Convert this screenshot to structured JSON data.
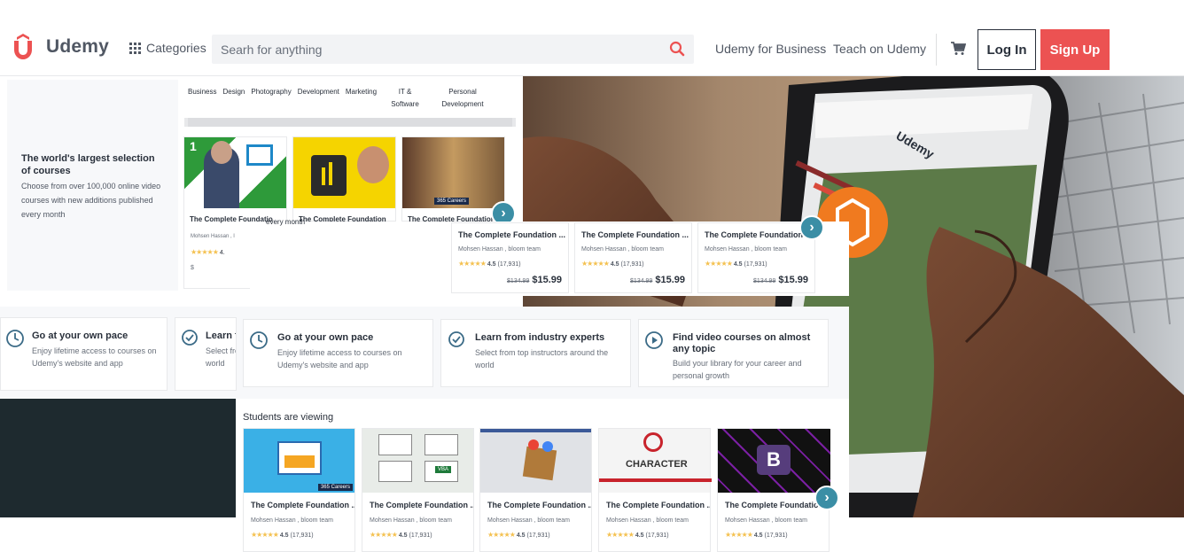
{
  "header": {
    "logo_text": "Udemy",
    "categories_label": "Categories",
    "search_placeholder": "Searh for anything",
    "business_link": "Udemy for Business",
    "teach_link": "Teach on Udemy",
    "login_label": "Log In",
    "signup_label": "Sign Up"
  },
  "colors": {
    "brand": "#ec5252",
    "accent": "#3b8ea5",
    "star": "#f4c150"
  },
  "hero": {
    "title": "The world's largest selection of courses",
    "subtitle": "Choose from over 100,000 online video courses with new additions published every month",
    "overlap_fragment": "every month",
    "tabs": [
      "Business",
      "Design",
      "Photography",
      "Development",
      "Marketing",
      "IT & Software",
      "Personal Development"
    ]
  },
  "small_cards": [
    {
      "title": "The Complete Foundatio",
      "author": "Mohsen Hassan , l",
      "rating": "4.",
      "old_price": "$"
    },
    {
      "title": "The Complete Foundation",
      "author": "",
      "rating": "",
      "old_price": ""
    },
    {
      "title": "The Complete Foundation",
      "author": "",
      "rating": "",
      "old_price": ""
    }
  ],
  "mid_cards": [
    {
      "title": "The Complete Foundation ...",
      "author": "Mohsen Hassan , bloom team",
      "rating": "4.5",
      "reviews": "(17,931)",
      "old_price": "$134.99",
      "price": "$15.99"
    },
    {
      "title": "The Complete Foundation ...",
      "author": "Mohsen Hassan , bloom team",
      "rating": "4.5",
      "reviews": "(17,931)",
      "old_price": "$134.99",
      "price": "$15.99"
    },
    {
      "title": "The Complete Foundation ...",
      "author": "Mohsen Hassan , bloom team",
      "rating": "4.5",
      "reviews": "(17,931)",
      "old_price": "$134.99",
      "price": "$15.99"
    }
  ],
  "features_left": [
    {
      "title": "Go at your own pace",
      "desc1": "Enjoy lifetime access to courses on",
      "desc2": "Udemy's website and app"
    },
    {
      "title": "Learn fr",
      "desc1": "Select fro",
      "desc2": "world"
    }
  ],
  "features": [
    {
      "title": "Go at your own pace",
      "desc1": "Enjoy lifetime access to courses on",
      "desc2": "Udemy's website and app"
    },
    {
      "title": "Learn from industry experts",
      "desc1": "Select from top instructors around the",
      "desc2": "world"
    },
    {
      "title": "Find video courses on almost",
      "title2": "any topic",
      "desc1": "Build your library for your career and",
      "desc2": "personal growth"
    }
  ],
  "students_viewing": {
    "heading": "Students are viewing",
    "cards": [
      {
        "title": "The Complete Foundation ...",
        "author": "Mohsen Hassan , bloom team",
        "rating": "4.5",
        "reviews": "(17,931)",
        "badge": "365 Careers"
      },
      {
        "title": "The Complete Foundation ...",
        "author": "Mohsen Hassan , bloom team",
        "rating": "4.5",
        "reviews": "(17,931)",
        "badge": "VBA"
      },
      {
        "title": "The Complete Foundation ...",
        "author": "Mohsen Hassan , bloom team",
        "rating": "4.5",
        "reviews": "(17,931)",
        "badge": ""
      },
      {
        "title": "The Complete Foundation ...",
        "author": "Mohsen Hassan , bloom team",
        "rating": "4.5",
        "reviews": "(17,931)",
        "badge": "CHARACTER"
      },
      {
        "title": "The Complete Foundation ...",
        "author": "Mohsen Hassan , bloom team",
        "rating": "4.5",
        "reviews": "(17,931)",
        "badge": "B"
      }
    ]
  },
  "small_card_badge": "365 Careers",
  "small_card_number": "1",
  "phone_logo_text": "Udemy"
}
